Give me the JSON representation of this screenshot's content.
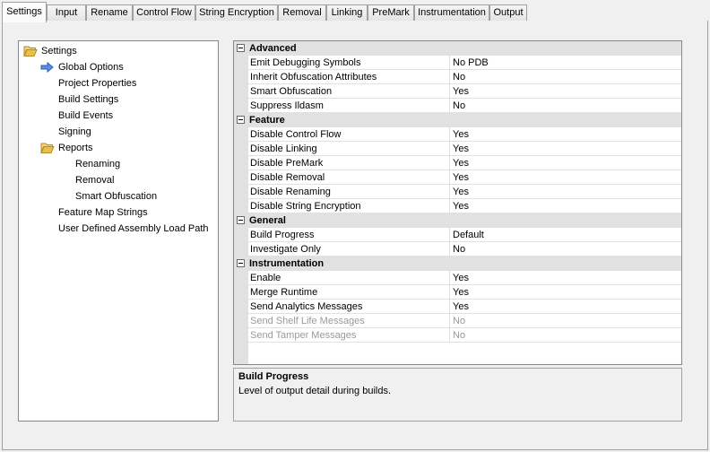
{
  "tabs": [
    {
      "label": "Settings",
      "active": true
    },
    {
      "label": "Input"
    },
    {
      "label": "Rename"
    },
    {
      "label": "Control Flow"
    },
    {
      "label": "String Encryption"
    },
    {
      "label": "Removal"
    },
    {
      "label": "Linking"
    },
    {
      "label": "PreMark"
    },
    {
      "label": "Instrumentation"
    },
    {
      "label": "Output"
    }
  ],
  "tree": {
    "items": [
      {
        "label": "Settings",
        "icon": "folder-open-icon",
        "level": 0
      },
      {
        "label": "Global Options",
        "icon": "arrow-right-icon",
        "level": 1,
        "selected": true
      },
      {
        "label": "Project Properties",
        "level": 1
      },
      {
        "label": "Build Settings",
        "level": 1
      },
      {
        "label": "Build Events",
        "level": 1
      },
      {
        "label": "Signing",
        "level": 1
      },
      {
        "label": "Reports",
        "icon": "folder-open-icon",
        "level": 1
      },
      {
        "label": "Renaming",
        "level": 2
      },
      {
        "label": "Removal",
        "level": 2
      },
      {
        "label": "Smart Obfuscation",
        "level": 2
      },
      {
        "label": "Feature Map Strings",
        "level": 1
      },
      {
        "label": "User Defined Assembly Load Path",
        "level": 1
      }
    ]
  },
  "grid": {
    "categories": [
      {
        "title": "Advanced",
        "props": [
          {
            "name": "Emit Debugging Symbols",
            "value": "No PDB"
          },
          {
            "name": "Inherit Obfuscation Attributes",
            "value": "No"
          },
          {
            "name": "Smart Obfuscation",
            "value": "Yes"
          },
          {
            "name": "Suppress Ildasm",
            "value": "No"
          }
        ]
      },
      {
        "title": "Feature",
        "props": [
          {
            "name": "Disable Control Flow",
            "value": "Yes"
          },
          {
            "name": "Disable Linking",
            "value": "Yes"
          },
          {
            "name": "Disable PreMark",
            "value": "Yes"
          },
          {
            "name": "Disable Removal",
            "value": "Yes"
          },
          {
            "name": "Disable Renaming",
            "value": "Yes"
          },
          {
            "name": "Disable String Encryption",
            "value": "Yes"
          }
        ]
      },
      {
        "title": "General",
        "props": [
          {
            "name": "Build Progress",
            "value": "Default"
          },
          {
            "name": "Investigate Only",
            "value": "No"
          }
        ]
      },
      {
        "title": "Instrumentation",
        "props": [
          {
            "name": "Enable",
            "value": "Yes"
          },
          {
            "name": "Merge Runtime",
            "value": "Yes"
          },
          {
            "name": "Send Analytics Messages",
            "value": "Yes"
          },
          {
            "name": "Send Shelf Life Messages",
            "value": "No",
            "disabled": true
          },
          {
            "name": "Send Tamper Messages",
            "value": "No",
            "disabled": true
          }
        ]
      }
    ]
  },
  "description": {
    "title": "Build Progress",
    "text": "Level of output detail during builds."
  },
  "colors": {
    "category_bg": "#e1e1e1",
    "selection_arrow": "#3c78d8",
    "folder": "#e8c04a",
    "disabled_text": "#9a9a9a"
  }
}
